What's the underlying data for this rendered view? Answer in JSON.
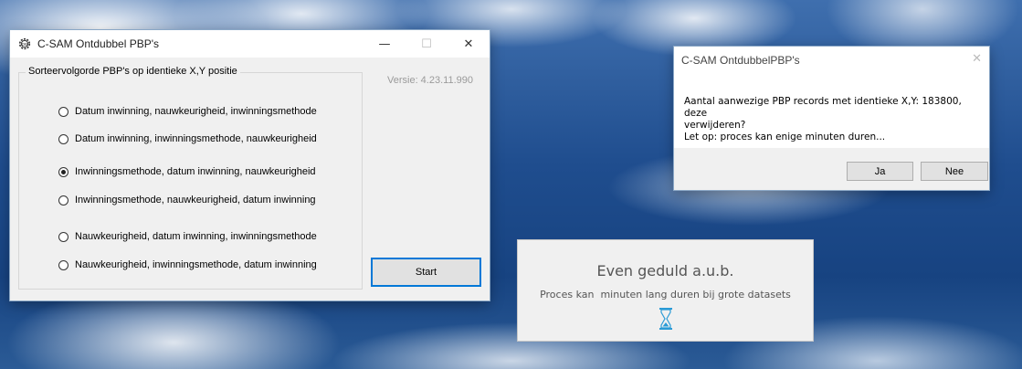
{
  "main_window": {
    "title": "C-SAM Ontdubbel PBP's",
    "group_title": "Sorteervolgorde PBP's op identieke X,Y positie",
    "version": "Versie: 4.23.11.990",
    "options": [
      {
        "label": "Datum inwinning, nauwkeurigheid, inwinningsmethode",
        "checked": false
      },
      {
        "label": "Datum inwinning, inwinningsmethode, nauwkeurigheid",
        "checked": false
      },
      {
        "label": "Inwinningsmethode, datum inwinning, nauwkeurigheid",
        "checked": true
      },
      {
        "label": "Inwinningsmethode, nauwkeurigheid, datum inwinning",
        "checked": false
      },
      {
        "label": "Nauwkeurigheid, datum inwinning, inwinningsmethode",
        "checked": false
      },
      {
        "label": "Nauwkeurigheid, inwinningsmethode, datum inwinning",
        "checked": false
      }
    ],
    "start_label": "Start",
    "minimize_glyph": "—",
    "maximize_glyph": "☐",
    "close_glyph": "✕"
  },
  "message_box": {
    "title": "C-SAM OntdubbelPBP's",
    "line1": "Aantal aanwezige PBP records met identieke X,Y: 183800, deze",
    "line2": "verwijderen?",
    "line3": "Let op: proces kan enige minuten duren...",
    "yes_label": "Ja",
    "no_label": "Nee",
    "close_glyph": "✕"
  },
  "wait_panel": {
    "title": "Even geduld a.u.b.",
    "subtitle": "Proces kan  minuten lang duren bij grote datasets",
    "icon": "hourglass-icon",
    "icon_color": "#2b9bd6"
  },
  "colors": {
    "accent": "#0078d7",
    "window_bg": "#f0f0f0"
  }
}
